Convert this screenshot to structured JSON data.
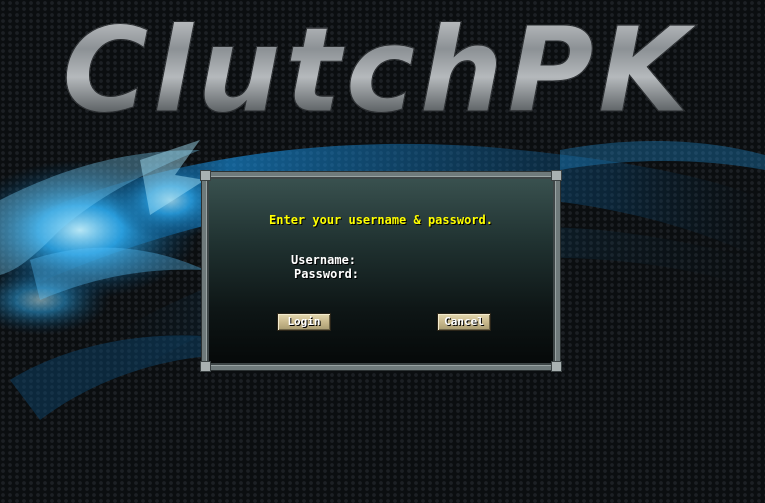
{
  "logo": {
    "text": "ClutchPK"
  },
  "login_dialog": {
    "prompt": "Enter your username & password.",
    "username_label": "Username:",
    "password_label": "Password:",
    "username_value": "",
    "password_value": "",
    "login_label": "Login",
    "cancel_label": "Cancel"
  },
  "colors": {
    "prompt_text": "#ffff00",
    "label_text": "#ffffff",
    "button_face": "#c6b68a",
    "dialog_border": "#6f7a7b",
    "background_glow": "#1ea8ff"
  }
}
